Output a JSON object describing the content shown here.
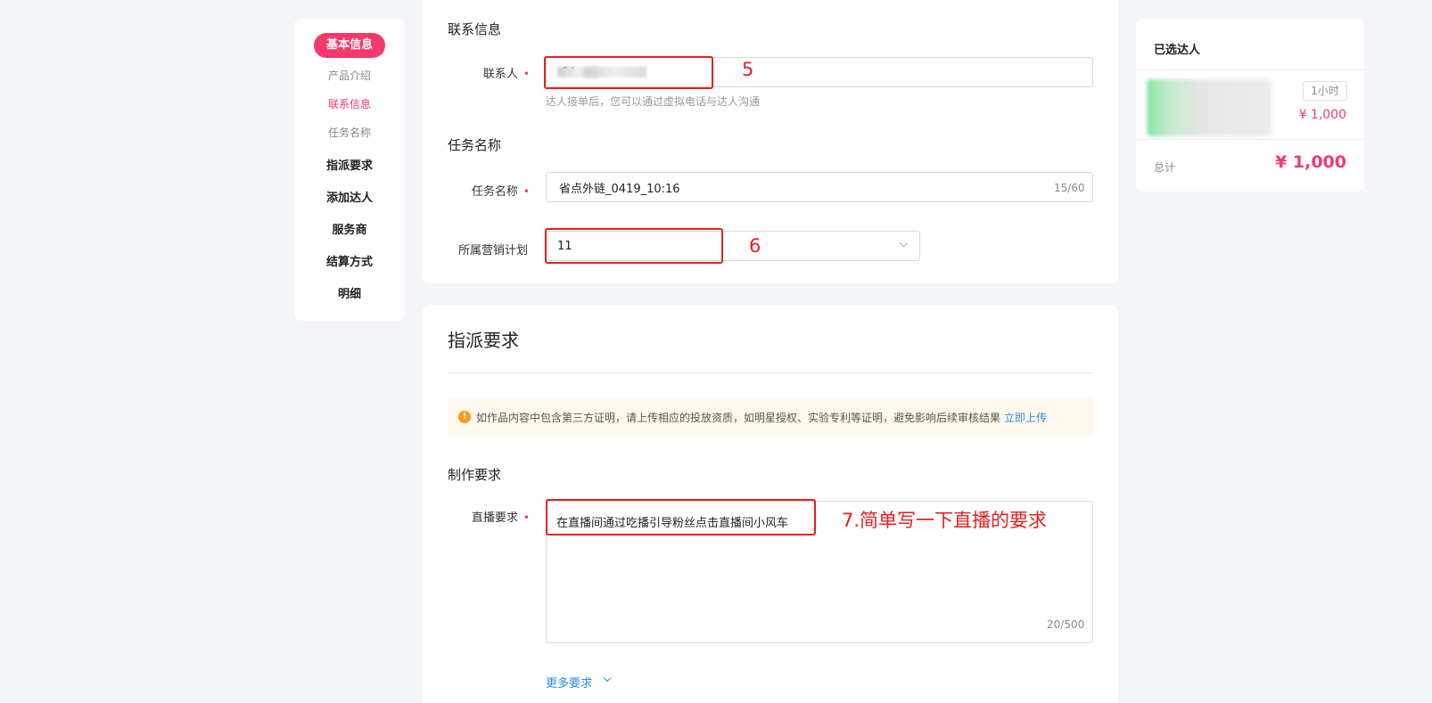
{
  "nav": {
    "active_pill": "基本信息",
    "sub_items": [
      "产品介绍",
      "联系信息",
      "任务名称"
    ],
    "active_sub_index": 1,
    "items": [
      "指派要求",
      "添加达人",
      "服务商",
      "结算方式",
      "明细"
    ]
  },
  "contact": {
    "section_title": "联系信息",
    "label": "联系人",
    "value_suffix": "64",
    "hint": "达人接单后，您可以通过虚拟电话与达人沟通",
    "annotation": "5"
  },
  "task": {
    "section_title": "任务名称",
    "label": "任务名称",
    "value": "省点外链_0419_10:16",
    "count": "15/60"
  },
  "plan": {
    "label": "所属营销计划",
    "value": "11",
    "annotation": "6"
  },
  "assign": {
    "section_title": "指派要求",
    "notice": "如作品内容中包含第三方证明，请上传相应的投放资质，如明星授权、实验专利等证明，避免影响后续审核结果",
    "notice_link": "立即上传",
    "notice_icon": "!",
    "production_title": "制作要求",
    "live_label": "直播要求",
    "live_value": "在直播间通过吃播引导粉丝点击直播间小风车",
    "live_count": "20/500",
    "annotation": "7.简单写一下直播的要求",
    "more": "更多要求"
  },
  "selected": {
    "title": "已选达人",
    "duration": "1小时",
    "price": "¥ 1,000",
    "total_label": "总计",
    "total_price": "¥ 1,000"
  },
  "colors": {
    "accent": "#f5396b",
    "annotation_red": "#e62020",
    "link": "#2a8bea",
    "warning": "#fa9c1b"
  }
}
